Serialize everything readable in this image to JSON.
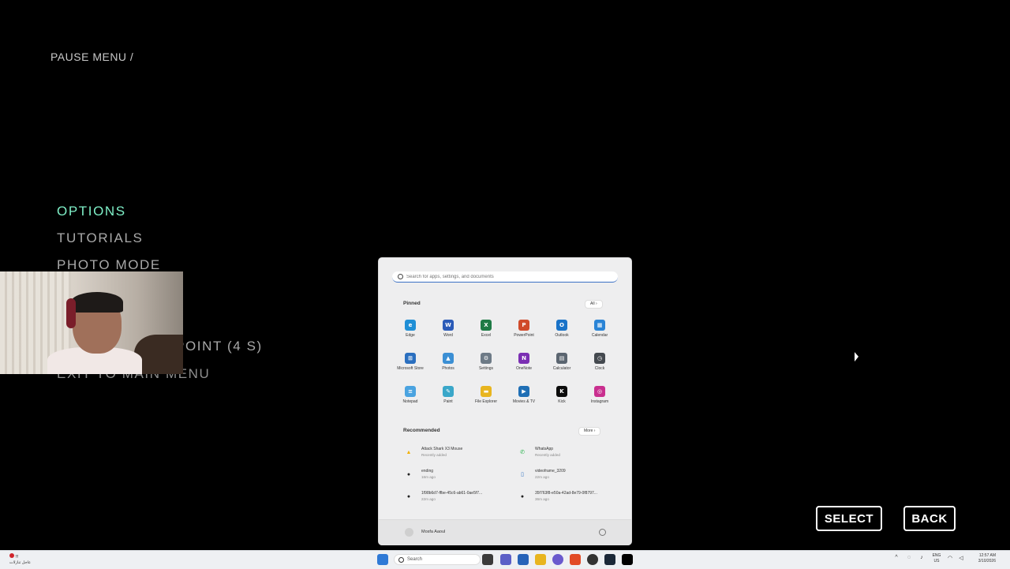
{
  "game": {
    "breadcrumb": "PAUSE MENU /",
    "menu": [
      {
        "label": "OPTIONS",
        "active": true
      },
      {
        "label": "TUTORIALS",
        "active": false
      },
      {
        "label": "PHOTO MODE",
        "active": false
      },
      {
        "label": "POINT   (4 S)",
        "active": false
      },
      {
        "label": "EXIT TO MAIN MENU",
        "active": false
      }
    ],
    "select_label": "SELECT",
    "back_label": "BACK"
  },
  "start_menu": {
    "search_placeholder": "Search for apps, settings, and documents",
    "pinned_title": "Pinned",
    "all_label": "All  ›",
    "pinned": [
      {
        "label": "Edge",
        "icon": "edge-icon",
        "color": "#1f8fd6",
        "glyph": "e"
      },
      {
        "label": "Word",
        "icon": "word-icon",
        "color": "#2b5bb8",
        "glyph": "W"
      },
      {
        "label": "Excel",
        "icon": "excel-icon",
        "color": "#1e7a45",
        "glyph": "X"
      },
      {
        "label": "PowerPoint",
        "icon": "powerpoint-icon",
        "color": "#d04a2a",
        "glyph": "P"
      },
      {
        "label": "Outlook",
        "icon": "outlook-icon",
        "color": "#1a73c8",
        "glyph": "O"
      },
      {
        "label": "Calendar",
        "icon": "calendar-icon",
        "color": "#2a84d6",
        "glyph": "▦"
      },
      {
        "label": "Microsoft Store",
        "icon": "store-icon",
        "color": "#2a6fbf",
        "glyph": "⊞"
      },
      {
        "label": "Photos",
        "icon": "photos-icon",
        "color": "#3b8fd4",
        "glyph": "▲"
      },
      {
        "label": "Settings",
        "icon": "settings-icon",
        "color": "#6d7a86",
        "glyph": "⚙"
      },
      {
        "label": "OneNote",
        "icon": "onenote-icon",
        "color": "#7b2fb3",
        "glyph": "N"
      },
      {
        "label": "Calculator",
        "icon": "calculator-icon",
        "color": "#5b6570",
        "glyph": "▤"
      },
      {
        "label": "Clock",
        "icon": "clock-icon",
        "color": "#44494f",
        "glyph": "◷"
      },
      {
        "label": "Notepad",
        "icon": "notepad-icon",
        "color": "#4aa3e0",
        "glyph": "≡"
      },
      {
        "label": "Paint",
        "icon": "paint-icon",
        "color": "#3aa7c9",
        "glyph": "✎"
      },
      {
        "label": "File Explorer",
        "icon": "folder-icon",
        "color": "#e8b51f",
        "glyph": "▬"
      },
      {
        "label": "Movies & TV",
        "icon": "movies-icon",
        "color": "#1f6fb5",
        "glyph": "▶"
      },
      {
        "label": "Kick",
        "icon": "kick-icon",
        "color": "#0c0c0c",
        "glyph": "K"
      },
      {
        "label": "Instagram",
        "icon": "instagram-icon",
        "color": "#c92f8f",
        "glyph": "◎"
      }
    ],
    "recommended_title": "Recommended",
    "more_label": "More  ›",
    "recommended": [
      {
        "name": "Attack Shark X3 Mouse",
        "sub": "Recently added",
        "icon": "shark-mouse-icon",
        "color": "#f2b100",
        "glyph": "▲"
      },
      {
        "name": "WhatsApp",
        "sub": "Recently added",
        "icon": "whatsapp-icon",
        "color": "#25b24a",
        "glyph": "✆"
      },
      {
        "name": "ending",
        "sub": "16m ago",
        "icon": "media-file-icon",
        "color": "#222222",
        "glyph": "●"
      },
      {
        "name": "videoframe_3209",
        "sub": "22m ago",
        "icon": "document-icon",
        "color": "#2d6fc1",
        "glyph": "▯"
      },
      {
        "name": "1f98b6d7-ffbe-45c6-ab61-0ae5f7...",
        "sub": "22m ago",
        "icon": "media-file-icon",
        "color": "#222222",
        "glyph": "●"
      },
      {
        "name": "35f763f8-e50a-42ad-8e79-0f8797...",
        "sub": "36m ago",
        "icon": "media-file-icon",
        "color": "#222222",
        "glyph": "●"
      }
    ],
    "user_name": "Mosfa Aaoul"
  },
  "taskbar": {
    "news_line1": "!!!",
    "news_line2": "عاجل تنازلات",
    "search_label": "Search",
    "lang_line1": "ENG",
    "lang_line2": "US",
    "time": "12:57 AM",
    "date": "3/10/2026"
  }
}
